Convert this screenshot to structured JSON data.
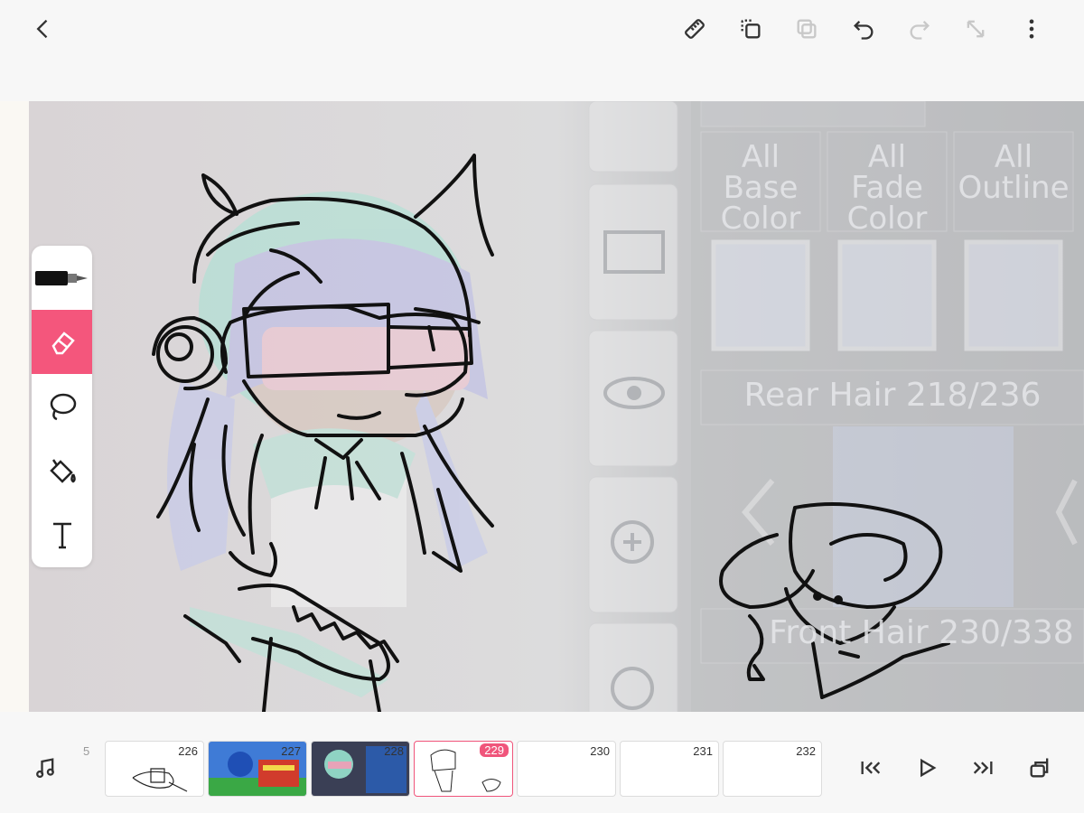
{
  "topbar": {
    "icons": [
      "back-icon",
      "ruler-icon",
      "duplicate-layer-icon",
      "paste-layer-icon",
      "undo-icon",
      "redo-icon",
      "resize-icon",
      "more-options-icon"
    ]
  },
  "canvas": {
    "game_ui": {
      "col_labels": [
        "All Base\nColor",
        "All Fade\nColor",
        "All\nOutline"
      ],
      "rear_hair": "Rear Hair 218/236",
      "front_hair": "Front Hair 230/338"
    }
  },
  "tools": {
    "items": [
      "pen",
      "eraser",
      "lasso",
      "fill",
      "text"
    ],
    "active": "eraser",
    "active_color": "#f4567c"
  },
  "timeline": {
    "frames": [
      {
        "num": "226"
      },
      {
        "num": "227"
      },
      {
        "num": "228"
      },
      {
        "num": "229",
        "current": true
      },
      {
        "num": "230"
      },
      {
        "num": "231"
      },
      {
        "num": "232"
      }
    ],
    "partial_left": "5",
    "controls": [
      "music-icon",
      "skip-to-start-icon",
      "play-icon",
      "skip-to-end-icon",
      "onion-layers-icon"
    ]
  }
}
